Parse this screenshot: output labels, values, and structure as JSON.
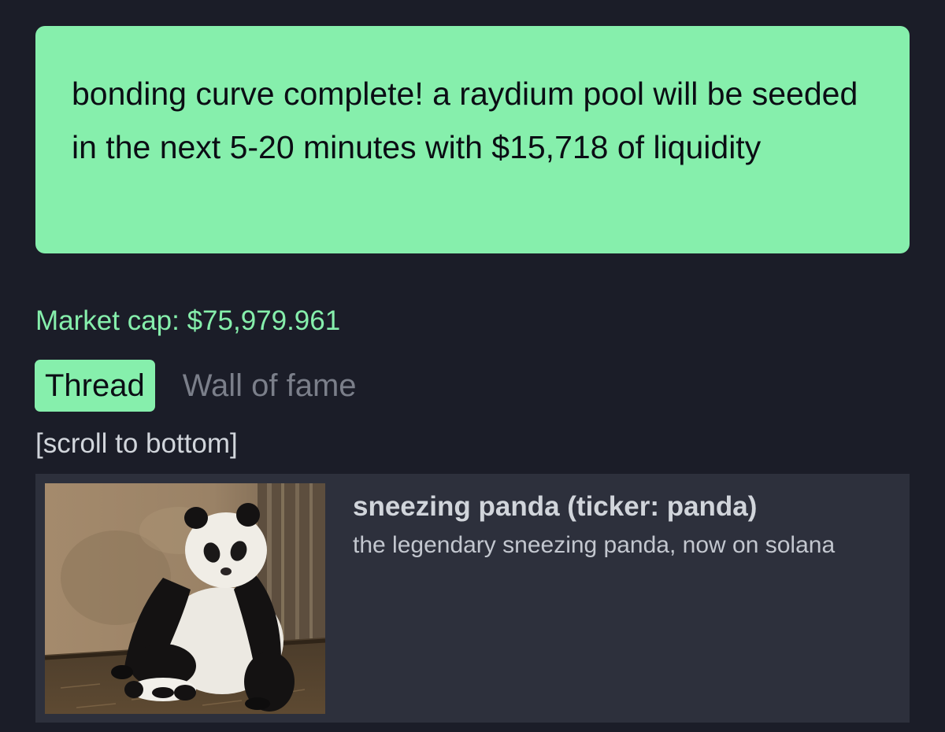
{
  "banner": {
    "message": "bonding curve complete! a raydium pool will be seeded in the next 5-20 minutes with $15,718 of liquidity"
  },
  "market_cap": {
    "text": "Market cap: $75,979.961"
  },
  "tabs": [
    {
      "label": "Thread",
      "active": true
    },
    {
      "label": "Wall of fame",
      "active": false
    }
  ],
  "scroll_link": "[scroll to bottom]",
  "coin_card": {
    "name": "sneezing panda (ticker: panda)",
    "description": "the legendary sneezing panda, now on solana",
    "image": "panda-photo"
  },
  "colors": {
    "background": "#1b1d28",
    "accent_green": "#86efac",
    "card_bg": "#2d303c",
    "muted_text": "#7b7f8a",
    "text": "#d1d5db"
  }
}
